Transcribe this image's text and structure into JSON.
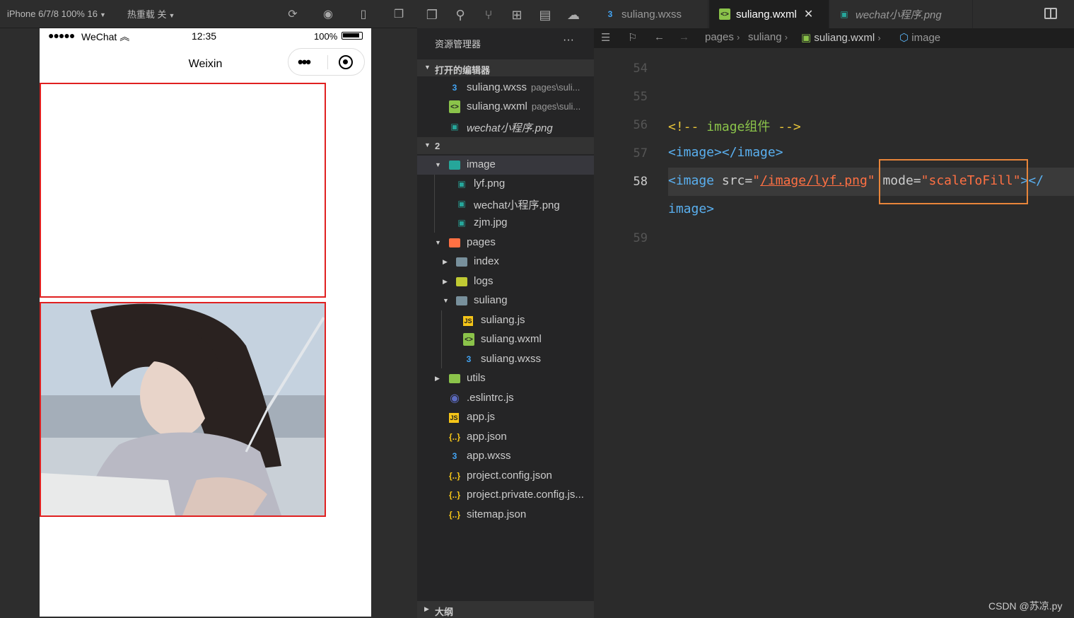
{
  "simulator": {
    "device_label": "iPhone 6/7/8 100% 16",
    "hot_reload_label": "热重载 关",
    "status": {
      "signal": "●●●●●",
      "carrier": "WeChat",
      "time": "12:35",
      "battery": "100%"
    },
    "nav_title": "Weixin"
  },
  "explorer": {
    "title": "资源管理器",
    "more": "···",
    "open_editors_label": "打开的编辑器",
    "open_editors": [
      {
        "name": "suliang.wxss",
        "path": "pages\\suli..."
      },
      {
        "name": "suliang.wxml",
        "path": "pages\\suli..."
      },
      {
        "name": "wechat小程序.png",
        "path": ""
      }
    ],
    "workspace_label": "2",
    "tree": [
      {
        "name": "image"
      },
      {
        "name": "lyf.png"
      },
      {
        "name": "wechat小程序.png"
      },
      {
        "name": "zjm.jpg"
      },
      {
        "name": "pages"
      },
      {
        "name": "index"
      },
      {
        "name": "logs"
      },
      {
        "name": "suliang"
      },
      {
        "name": "suliang.js"
      },
      {
        "name": "suliang.wxml"
      },
      {
        "name": "suliang.wxss"
      },
      {
        "name": "utils"
      },
      {
        "name": ".eslintrc.js"
      },
      {
        "name": "app.js"
      },
      {
        "name": "app.json"
      },
      {
        "name": "app.wxss"
      },
      {
        "name": "project.config.json"
      },
      {
        "name": "project.private.config.js..."
      },
      {
        "name": "sitemap.json"
      }
    ],
    "outline_label": "大纲"
  },
  "tabs": [
    {
      "label": "suliang.wxss",
      "active": false
    },
    {
      "label": "suliang.wxml",
      "active": true
    },
    {
      "label": "wechat小程序.png",
      "active": false
    }
  ],
  "breadcrumbs": [
    "pages",
    "suliang",
    "suliang.wxml",
    "image"
  ],
  "code": {
    "line_numbers": [
      "54",
      "55",
      "56",
      "57",
      "58",
      "59"
    ],
    "comment_open": "<!--",
    "comment_text": " image组件 ",
    "comment_close": "-->",
    "line57": "<image></image>",
    "l58_open": "<image",
    "l58_src_attr": " src=",
    "l58_src_q1": "\"",
    "l58_src_val": "/image/lyf.png",
    "l58_src_q2": "\"",
    "l58_mode_attr": " mode=",
    "l58_mode_val": "\"scaleToFill\"",
    "l58_close1": "></",
    "l58_cont": "image>"
  },
  "watermark": "CSDN @苏凉.py"
}
